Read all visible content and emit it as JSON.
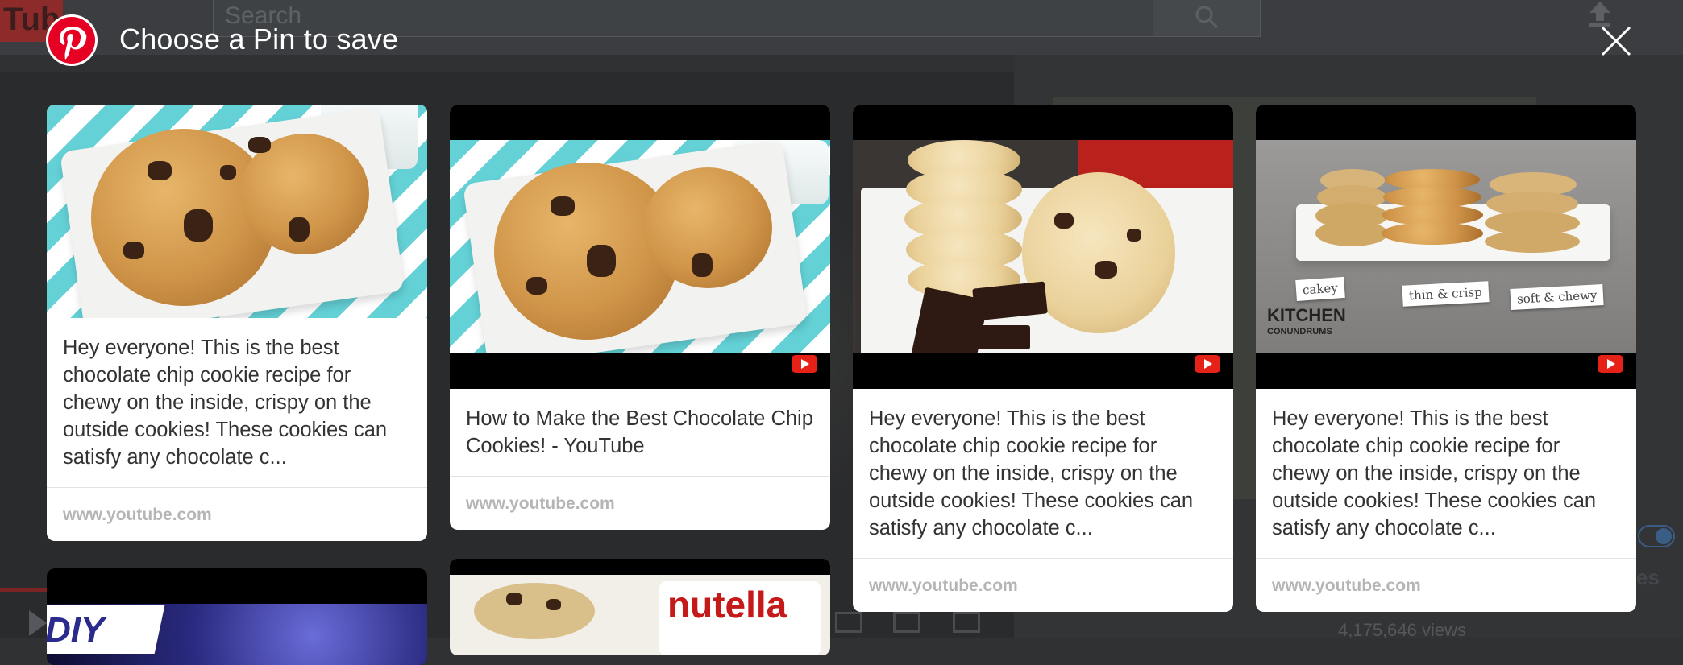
{
  "background": {
    "logo_text": "Tube",
    "search_placeholder": "Search",
    "sidebar_fragment": "es",
    "views_text": "4,175,646 views"
  },
  "modal": {
    "title": "Choose a Pin to save",
    "close_icon": "close-icon",
    "logo_icon": "pinterest-logo-icon",
    "accent_color": "#e60023"
  },
  "pins": [
    {
      "description": "Hey everyone! This is the best chocolate chip cookie recipe for chewy on the inside, crispy on the outside cookies! These cookies can satisfy any chocolate c...",
      "domain": "www.youtube.com",
      "has_video_badge": false
    },
    {
      "description": "How to Make the Best Chocolate Chip Cookies! - YouTube",
      "domain": "www.youtube.com",
      "has_video_badge": true
    },
    {
      "description": "Hey everyone! This is the best chocolate chip cookie recipe for chewy on the inside, crispy on the outside cookies! These cookies can satisfy any chocolate c...",
      "domain": "www.youtube.com",
      "has_video_badge": true
    },
    {
      "description": "Hey everyone! This is the best chocolate chip cookie recipe for chewy on the inside, crispy on the outside cookies! These cookies can satisfy any chocolate c...",
      "domain": "www.youtube.com",
      "has_video_badge": true,
      "image_labels": [
        "cakey",
        "thin & crisp",
        "soft & chewy"
      ],
      "image_brand": "KITCHEN",
      "image_brand_sub": "CONUNDRUMS"
    }
  ],
  "partial_pins": [
    {
      "image_text": "DIY"
    },
    {
      "image_text": "nutella"
    }
  ]
}
